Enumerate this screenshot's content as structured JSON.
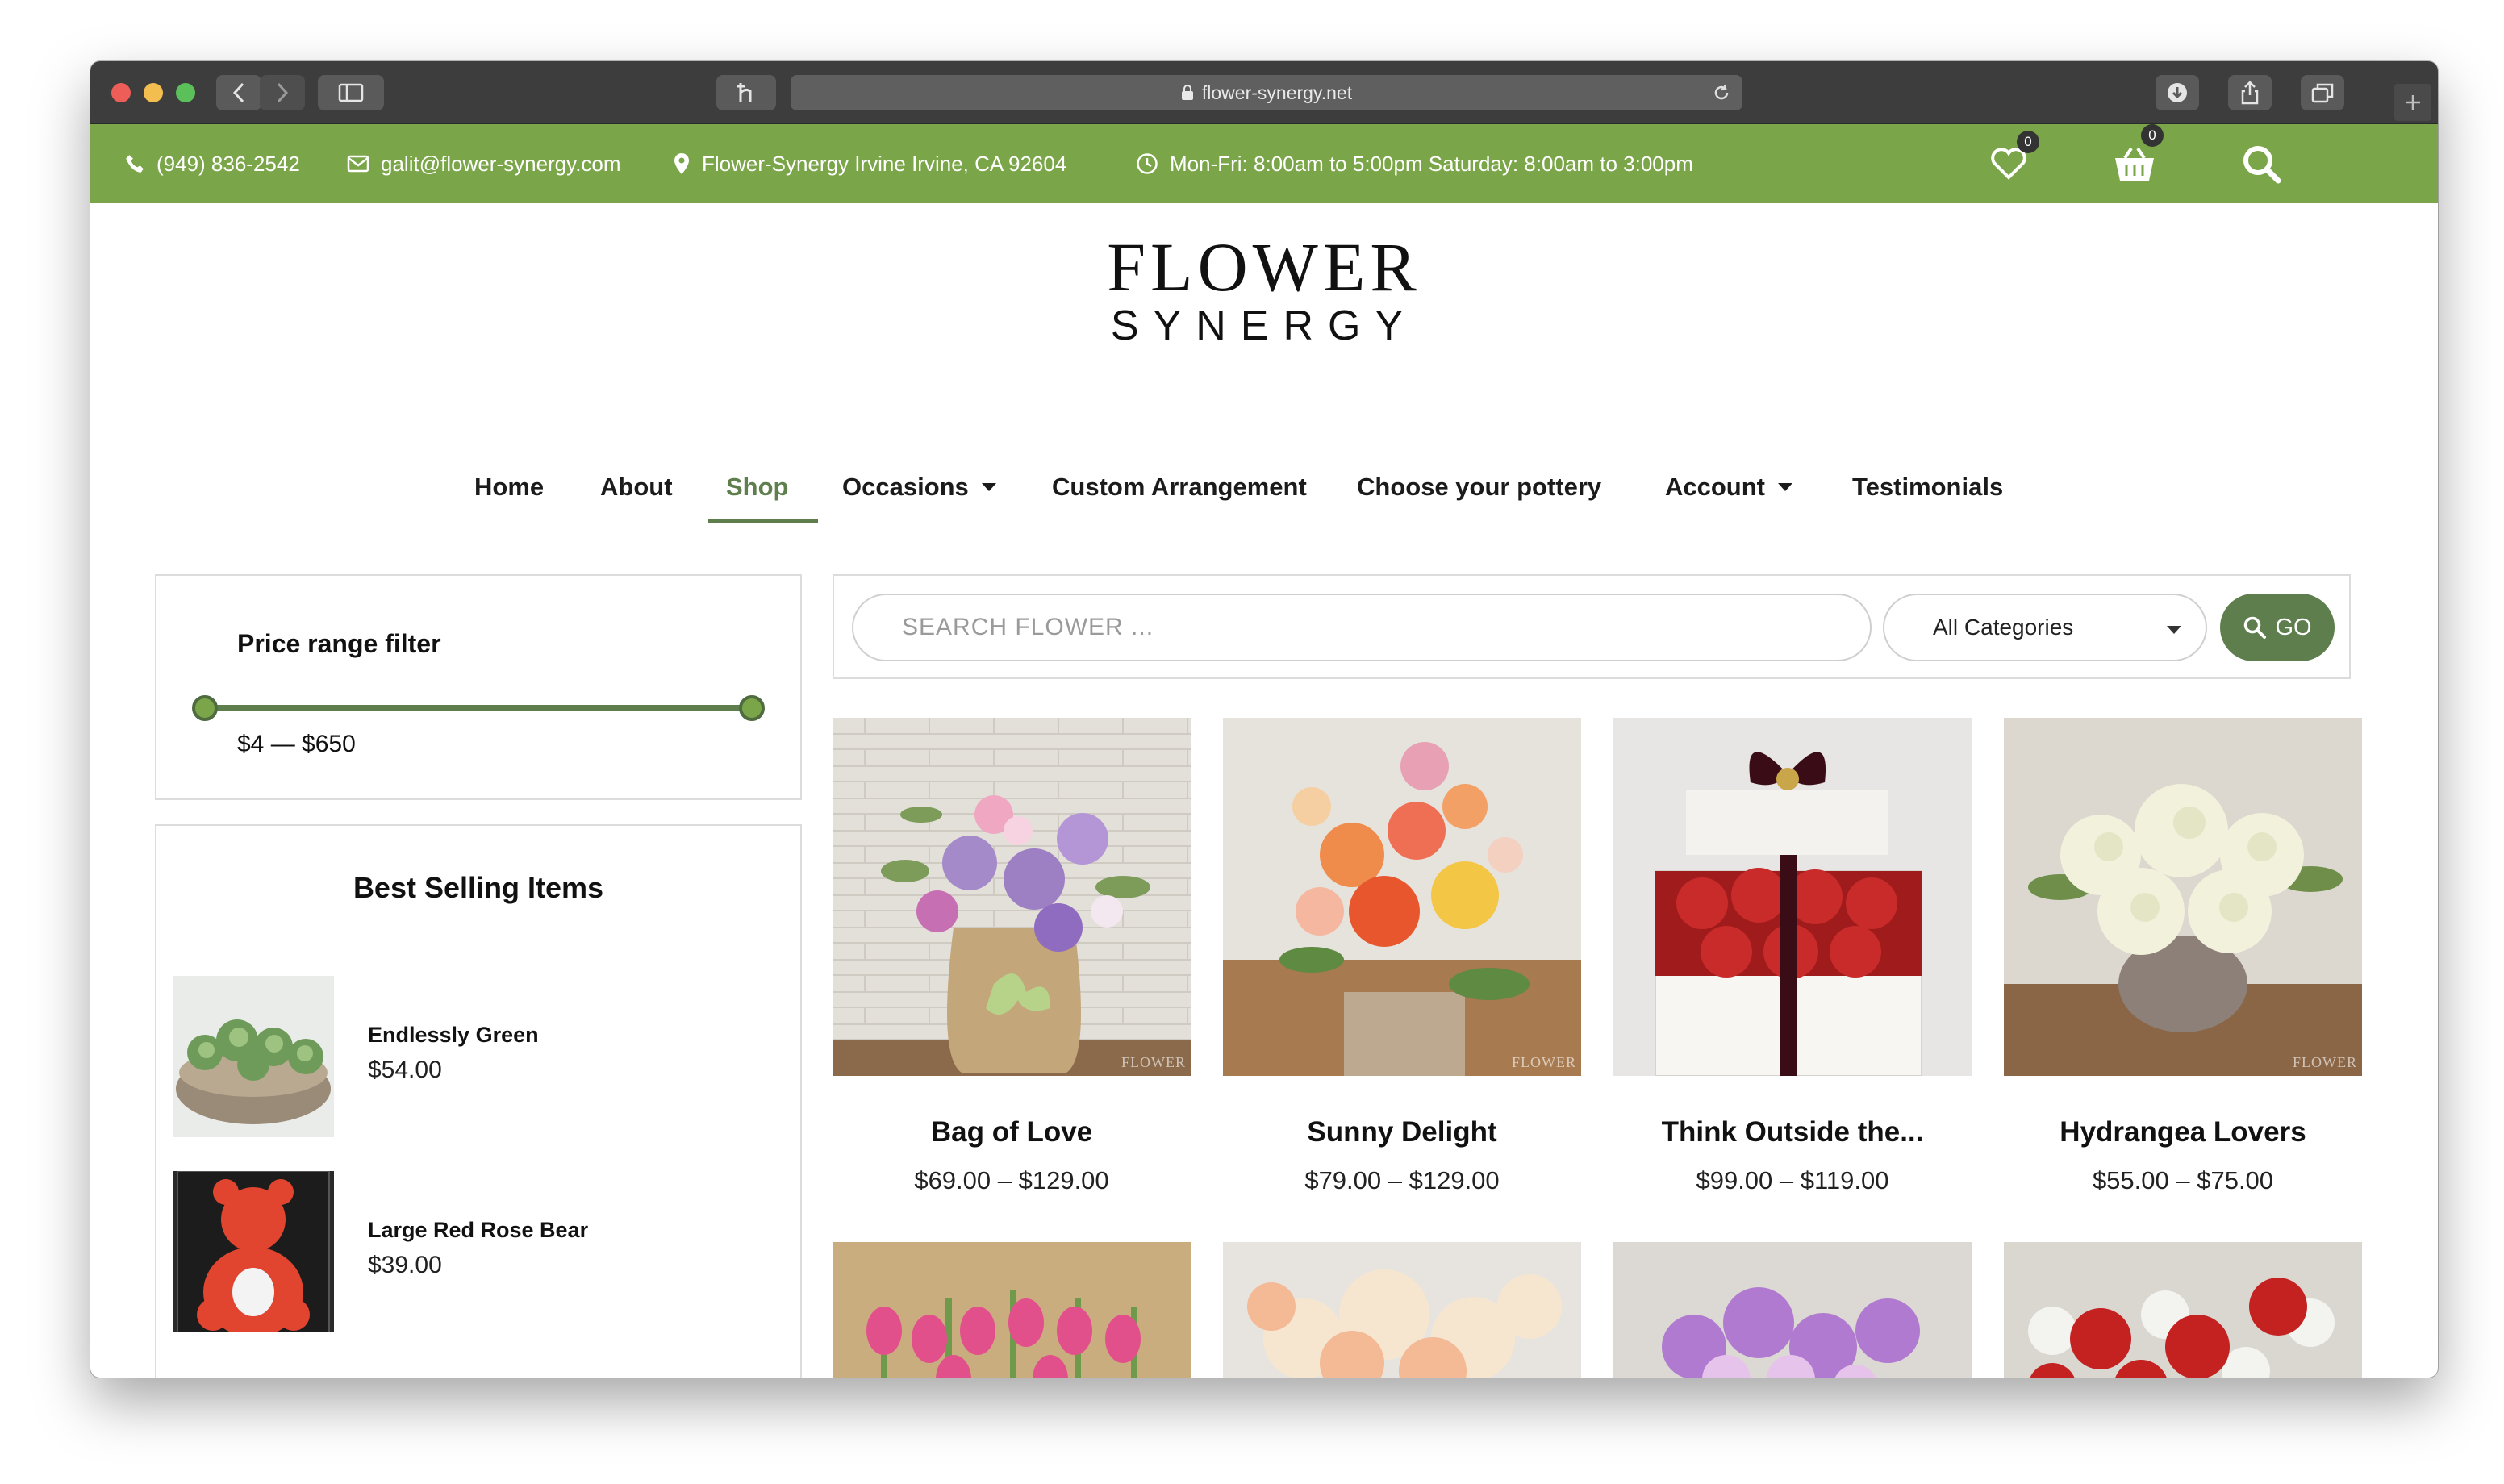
{
  "browser": {
    "url": "flower-synergy.net"
  },
  "topbar": {
    "phone": "(949) 836-2542",
    "email": "galit@flower-synergy.com",
    "address": "Flower-Synergy Irvine Irvine, CA 92604",
    "hours": "Mon-Fri: 8:00am to 5:00pm Saturday: 8:00am to 3:00pm",
    "wishlist_count": "0",
    "cart_count": "0"
  },
  "logo": {
    "line1": "FLOWER",
    "line2": "SYNERGY"
  },
  "nav": {
    "items": [
      {
        "label": "Home"
      },
      {
        "label": "About"
      },
      {
        "label": "Shop"
      },
      {
        "label": "Occasions"
      },
      {
        "label": "Custom Arrangement"
      },
      {
        "label": "Choose your pottery"
      },
      {
        "label": "Account"
      },
      {
        "label": "Testimonials"
      }
    ],
    "active": "Shop"
  },
  "price_filter": {
    "title": "Price range filter",
    "range_label": "$4 — $650",
    "min": 4,
    "max": 650
  },
  "best_selling": {
    "title": "Best Selling Items",
    "items": [
      {
        "name": "Endlessly Green",
        "price": "$54.00"
      },
      {
        "name": "Large Red Rose Bear",
        "price": "$39.00"
      }
    ]
  },
  "search": {
    "placeholder": "SEARCH FLOWER ...",
    "category": "All Categories",
    "go_label": "GO"
  },
  "products": [
    {
      "name": "Bag of Love",
      "price": "$69.00 – $129.00"
    },
    {
      "name": "Sunny Delight",
      "price": "$79.00 – $129.00"
    },
    {
      "name": "Think Outside the...",
      "price": "$99.00 – $119.00"
    },
    {
      "name": "Hydrangea Lovers",
      "price": "$55.00 – $75.00"
    }
  ],
  "colors": {
    "topbar_green": "#7aa548",
    "accent_green": "#5e7f4d"
  }
}
